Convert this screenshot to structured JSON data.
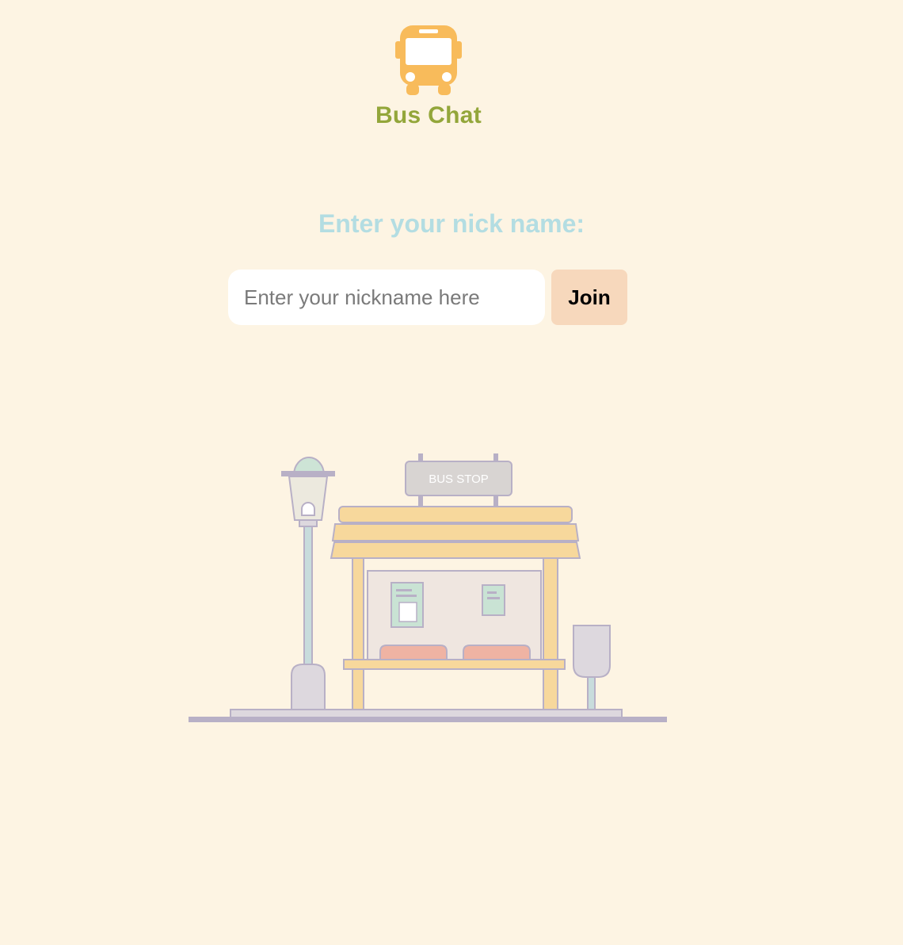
{
  "header": {
    "logo_icon": "bus-icon",
    "brand_name": "Bus Chat"
  },
  "join": {
    "prompt": "Enter your nick name:",
    "nickname_value": "",
    "nickname_placeholder": "Enter your nickname here",
    "join_label": "Join"
  },
  "illustration": {
    "icon": "bus-stop-illustration",
    "sign_text": "BUS STOP"
  },
  "colors": {
    "background": "#fdf4e3",
    "brand_text": "#93a63a",
    "bus_icon": "#f8bb5b",
    "prompt_text": "#b3dde2",
    "join_button": "#f7d8bc"
  }
}
